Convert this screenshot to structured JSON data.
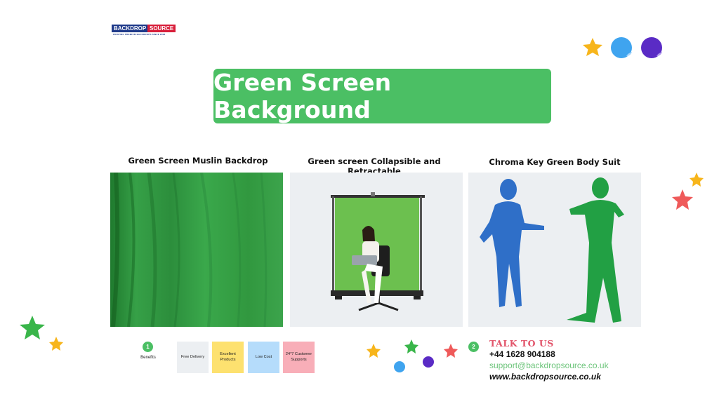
{
  "logo": {
    "part1": "BACKDROP",
    "part2": "SOURCE",
    "tagline": "PRINTING PREMIUM BACKDROPS SINCE 2008"
  },
  "title": "Green Screen Background",
  "products": [
    {
      "caption": "Green Screen Muslin Backdrop",
      "image_icon": "green-muslin-backdrop-photo"
    },
    {
      "caption": "Green screen Collapsible and Retractable",
      "image_icon": "retractable-green-screen-photo"
    },
    {
      "caption": "Chroma Key Green Body Suit",
      "image_icon": "chroma-key-body-suits-photo"
    }
  ],
  "benefits": {
    "number": "1",
    "label": "Benefits",
    "cards": [
      {
        "text": "Free Delivery",
        "color": "#eceff2"
      },
      {
        "text": "Excellent Products",
        "color": "#fde16f"
      },
      {
        "text": "Low Cost",
        "color": "#b5dcfb"
      },
      {
        "text": "24*7 Customer Supports",
        "color": "#f8aeb8"
      }
    ]
  },
  "contact": {
    "number": "2",
    "heading": "TALK TO US",
    "phone": "+44 1628 904188",
    "email": "support@backdropsource.co.uk",
    "website": "www.backdropsource.co.uk"
  },
  "colors": {
    "accent_green": "#4bbf64",
    "heading_red": "#e2546a",
    "email_green": "#6cc47a"
  }
}
